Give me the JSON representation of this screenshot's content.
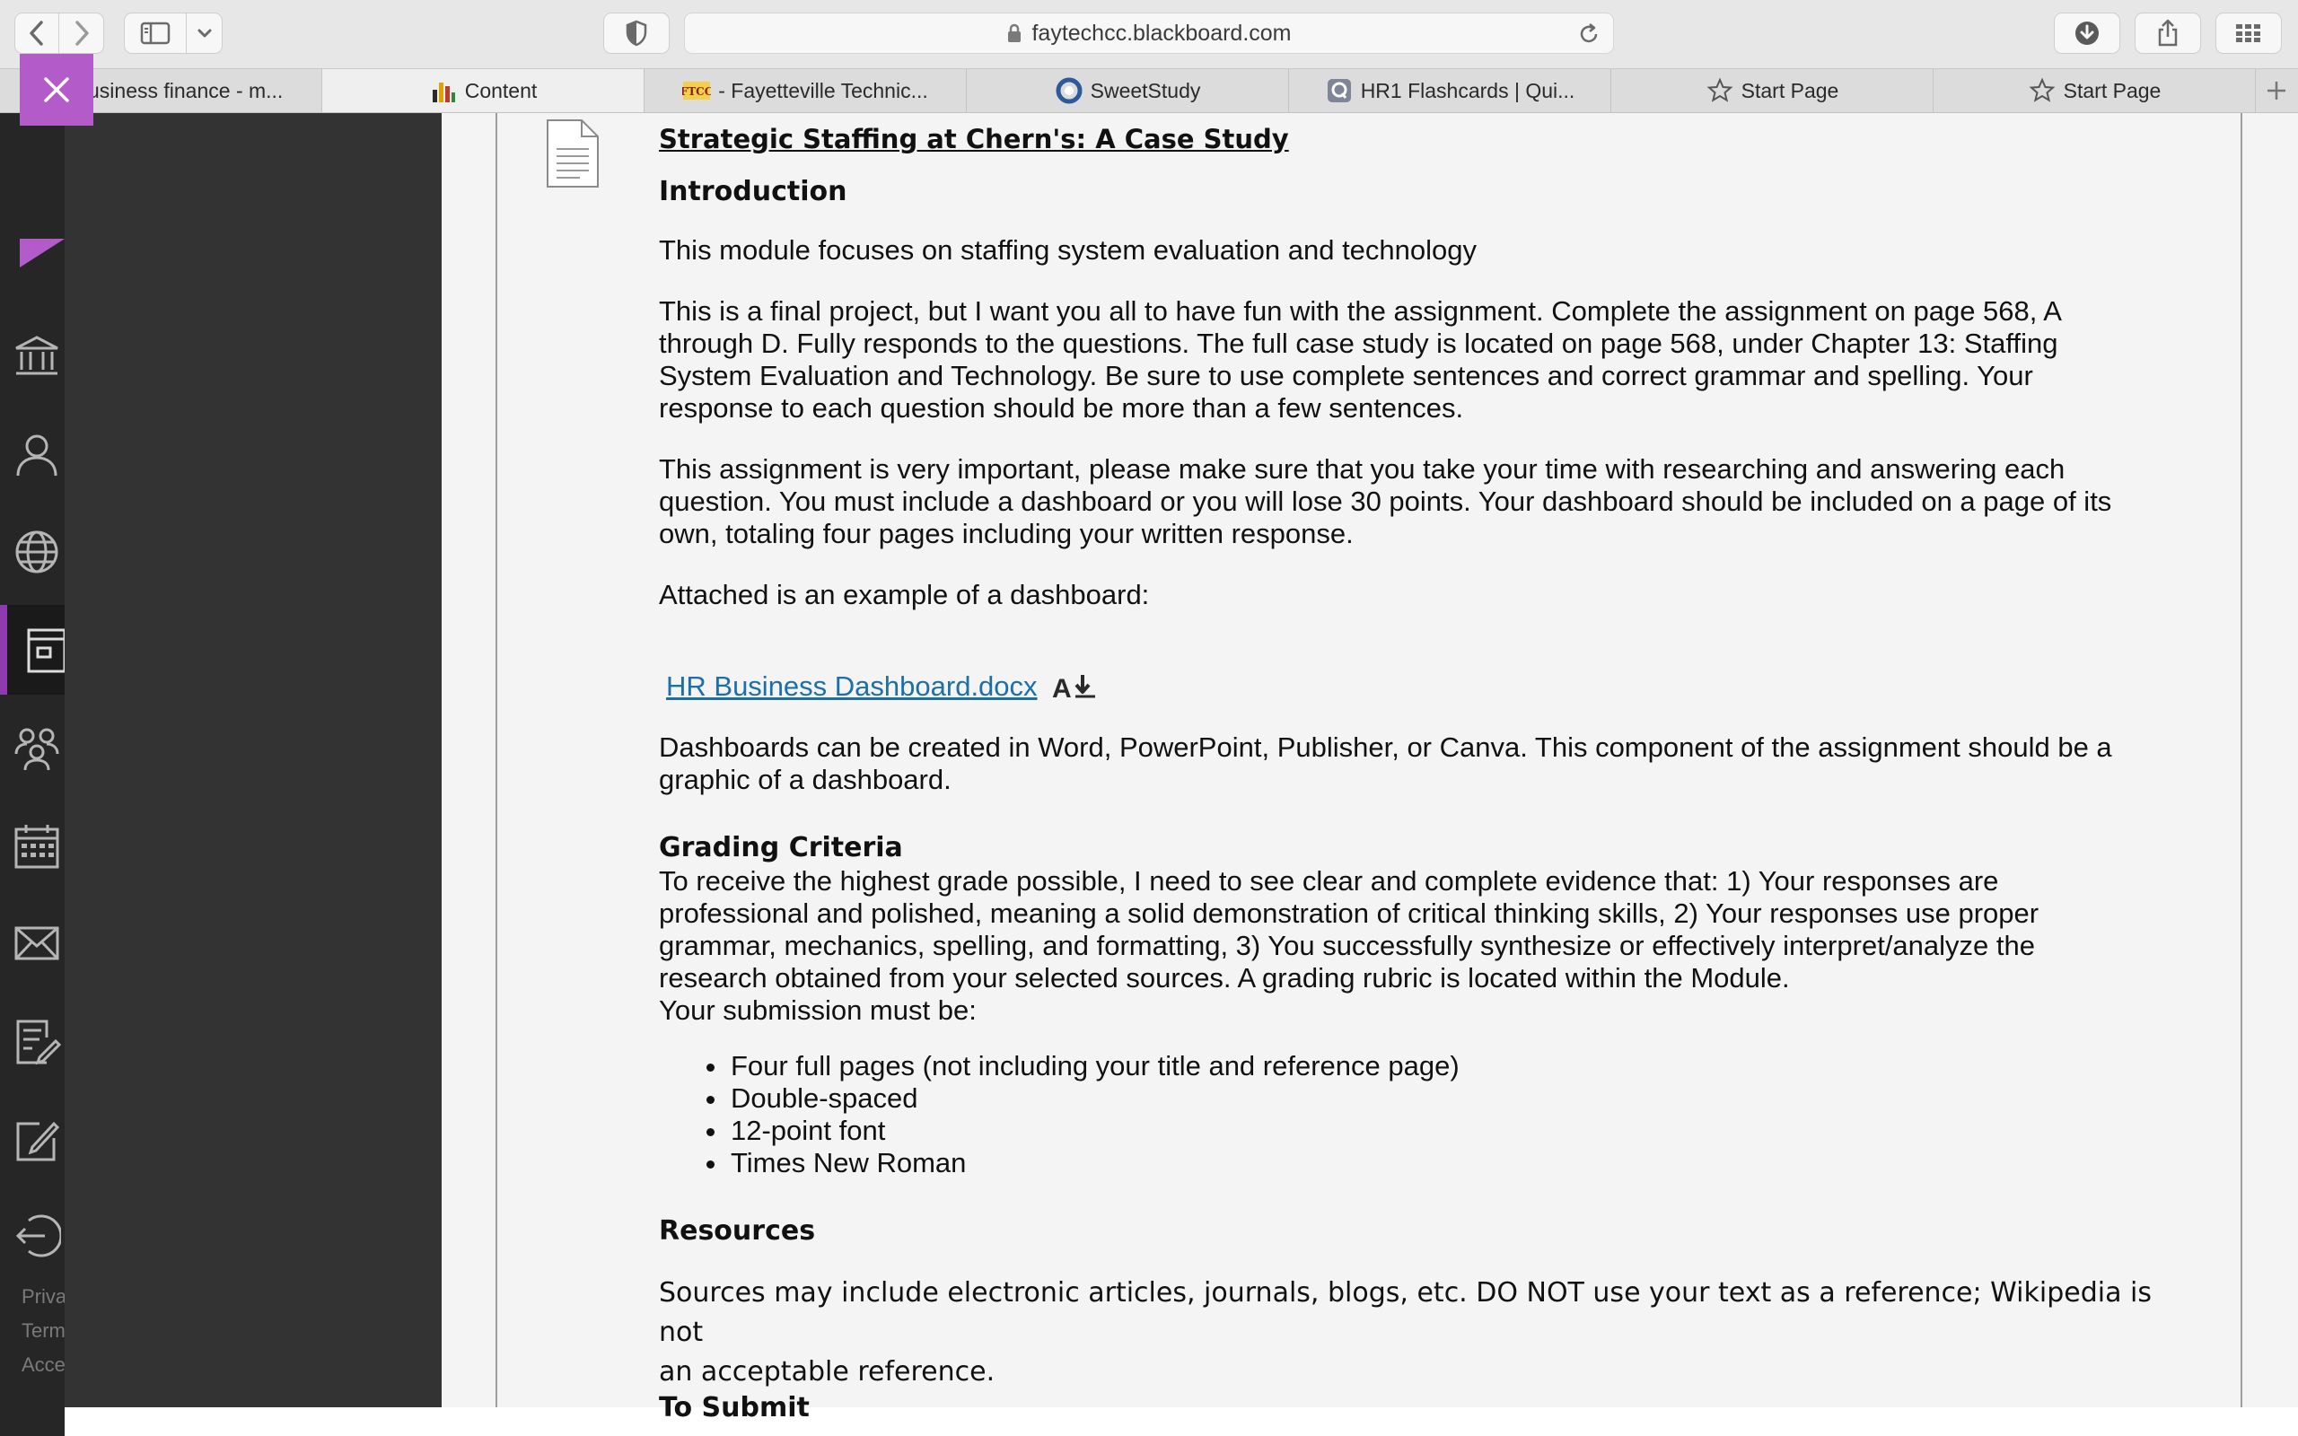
{
  "browser": {
    "url": "faytechcc.blackboard.com",
    "tabs": [
      {
        "label": "Business finance - m...",
        "favicon": "sweetstudy-icon",
        "active": false
      },
      {
        "label": "Content",
        "favicon": "bar-chart-icon",
        "active": true
      },
      {
        "label": "- Fayetteville Technic...",
        "favicon": "ftcc-logo-icon",
        "active": false
      },
      {
        "label": "SweetStudy",
        "favicon": "sweetstudy-icon",
        "active": false
      },
      {
        "label": "HR1 Flashcards | Qui...",
        "favicon": "quizlet-icon",
        "active": false
      },
      {
        "label": "Start Page",
        "favicon": "star-icon",
        "active": false
      },
      {
        "label": "Start Page",
        "favicon": "star-icon",
        "active": false
      }
    ]
  },
  "sidenav": {
    "footer": [
      "Privacy",
      "Terms",
      "Accessibility"
    ],
    "icons": [
      "institution-icon",
      "profile-icon",
      "globe-icon",
      "courses-icon",
      "groups-icon",
      "calendar-icon",
      "messages-icon",
      "grades-icon",
      "tools-icon",
      "sign-out-icon"
    ],
    "accent": "#b25bc9"
  },
  "content": {
    "title": "Strategic Staffing at Chern's: A Case Study",
    "intro_heading": "Introduction",
    "p1": "This module focuses on staffing system evaluation and technology",
    "p2_lines": [
      "This is a final project, but I want you all to have fun with the assignment.  Complete the assignment on page 568, A",
      "through D. Fully responds to the questions. The full case study is located on page 568, under Chapter 13: Staffing",
      "System Evaluation and Technology.  Be sure to use complete sentences and correct grammar and spelling. Your",
      "response to each question should be more than a few sentences."
    ],
    "p3_lines": [
      "This assignment is very important, please make sure that you take your time with researching and answering each",
      "question. You must include a dashboard or you will lose 30 points. Your dashboard should be included on a page of its",
      "own, totaling four pages including your written response."
    ],
    "p4": "Attached is an example of a dashboard:",
    "attachment": "HR Business Dashboard.docx",
    "p5_lines": [
      "Dashboards can be created in Word, PowerPoint, Publisher, or Canva. This component of the assignment should be a",
      "graphic of a dashboard."
    ],
    "grading_heading": "Grading Criteria",
    "grading_lines": [
      "To receive the highest grade possible, I need to see clear and complete evidence that: 1) Your responses are",
      "professional and polished, meaning a solid demonstration of critical thinking skills, 2) Your responses use proper",
      "grammar, mechanics, spelling, and formatting, 3) You successfully synthesize or effectively interpret/analyze the",
      "research obtained from your selected sources. A grading rubric is located within the Module.",
      "Your submission must be:"
    ],
    "requirements": [
      "Four full pages (not including your title and reference page)",
      "Double-spaced",
      "12-point font",
      "Times New Roman"
    ],
    "resources_heading": "Resources",
    "resources_lines": [
      "Sources may include electronic articles, journals, blogs, etc. DO NOT use your text as a reference; Wikipedia is not",
      "an acceptable reference."
    ],
    "submit_heading": "To Submit"
  }
}
